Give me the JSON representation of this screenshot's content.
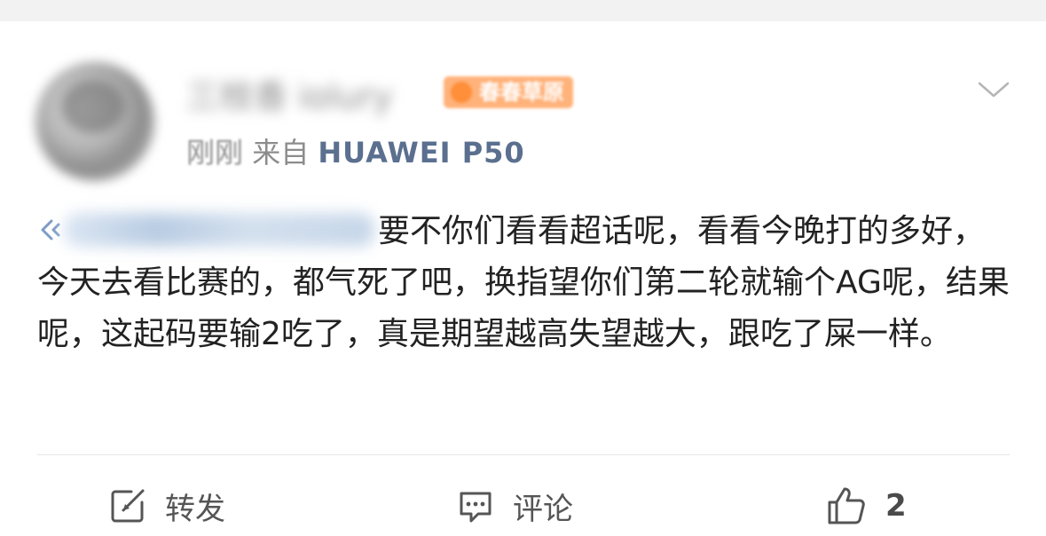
{
  "post": {
    "username": "三枝香 iolury",
    "badge_label": "春春草原",
    "time": "刚刚",
    "source_prefix": "来自",
    "device": "HUAWEI P50",
    "body": "要不你们看看超话呢，看看今晚打的多好，今天去看比赛的，都气死了吧，换指望你们第二轮就输个AG呢，结果呢，这起码要输2吃了，真是期望越高失望越大，跟吃了屎一样。"
  },
  "actions": {
    "repost_label": "转发",
    "comment_label": "评论",
    "like_count": "2"
  },
  "colors": {
    "device_link": "#5b6f8f",
    "badge": "#ffb27a",
    "text": "#222222",
    "meta": "#8c8c8c"
  },
  "icons": {
    "chevron": "chevron-down-icon",
    "super_topic": "super-topic-icon",
    "repost": "repost-icon",
    "comment": "comment-icon",
    "like": "thumbs-up-icon"
  }
}
